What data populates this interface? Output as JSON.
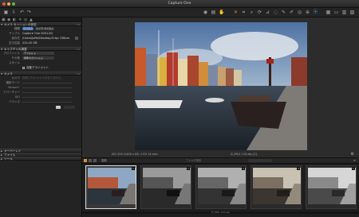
{
  "window": {
    "title": "Capture One"
  },
  "toolbar": {
    "icons": [
      "camera-icon",
      "adjust-icon",
      "crop-icon",
      "cursor-icon",
      "pan-icon",
      "zoom-icon",
      "rotate-icon",
      "keystone-icon",
      "spot-icon",
      "picker-icon",
      "mask-icon",
      "erase-icon",
      "color-icon",
      "view-icon",
      "grid-icon",
      "layout-icon",
      "print-icon",
      "share-icon"
    ]
  },
  "left_panel": {
    "sections": {
      "capture_location": "カメラ セッションの設定",
      "metadata_header": "画像",
      "capture": "カメラ",
      "composition": "キャプチャの調整",
      "overlay": "オーバーレイ",
      "file": "ファイル",
      "tasks": "ツール"
    },
    "location": {
      "format_label": "種類",
      "format_a": "カスタム",
      "format_b": "カメラ カスタム",
      "sample_label": "サンプル",
      "sample_value": "Capture One 0001.IIQ",
      "path_label": "保存先",
      "path_value": "/Users/Jaffe/Desktop/Crisp 15Born",
      "free_label": "空き容量",
      "free_value": "224.42 GB"
    },
    "capture_settings": {
      "profile_label": "プロファイル",
      "profile_value": "デフォルト",
      "style_label": "その他",
      "style_value": "標準ネガフィルム",
      "preset_label": "スタイル",
      "checkbox_label": "自動アライメント"
    },
    "camera": {
      "camera_label": "カメラ",
      "camera_value": "接続されたカメラがありません",
      "model_label": "撮影モード",
      "iso_label": "Sensor+",
      "aperture_label": "アパーチャー",
      "shutter_label": "ISO",
      "wb_label": "バランス"
    }
  },
  "viewer": {
    "exif": "ISO 200    1/400 s    f/8    -1 EV    14 mm",
    "filename": "D_ER/1 115.eip [1]"
  },
  "browser": {
    "sort_label": "名前",
    "search_placeholder": "フォルダ検索",
    "thumbnails": [
      {
        "badge": "1",
        "caption": "",
        "selected": true
      },
      {
        "badge": "2",
        "caption": "",
        "selected": false
      },
      {
        "badge": "3",
        "caption": "",
        "selected": false
      },
      {
        "badge": "4",
        "caption": "",
        "selected": false
      },
      {
        "badge": "5",
        "caption": "",
        "selected": false
      }
    ],
    "status": "D_ER/1 115.eip"
  }
}
